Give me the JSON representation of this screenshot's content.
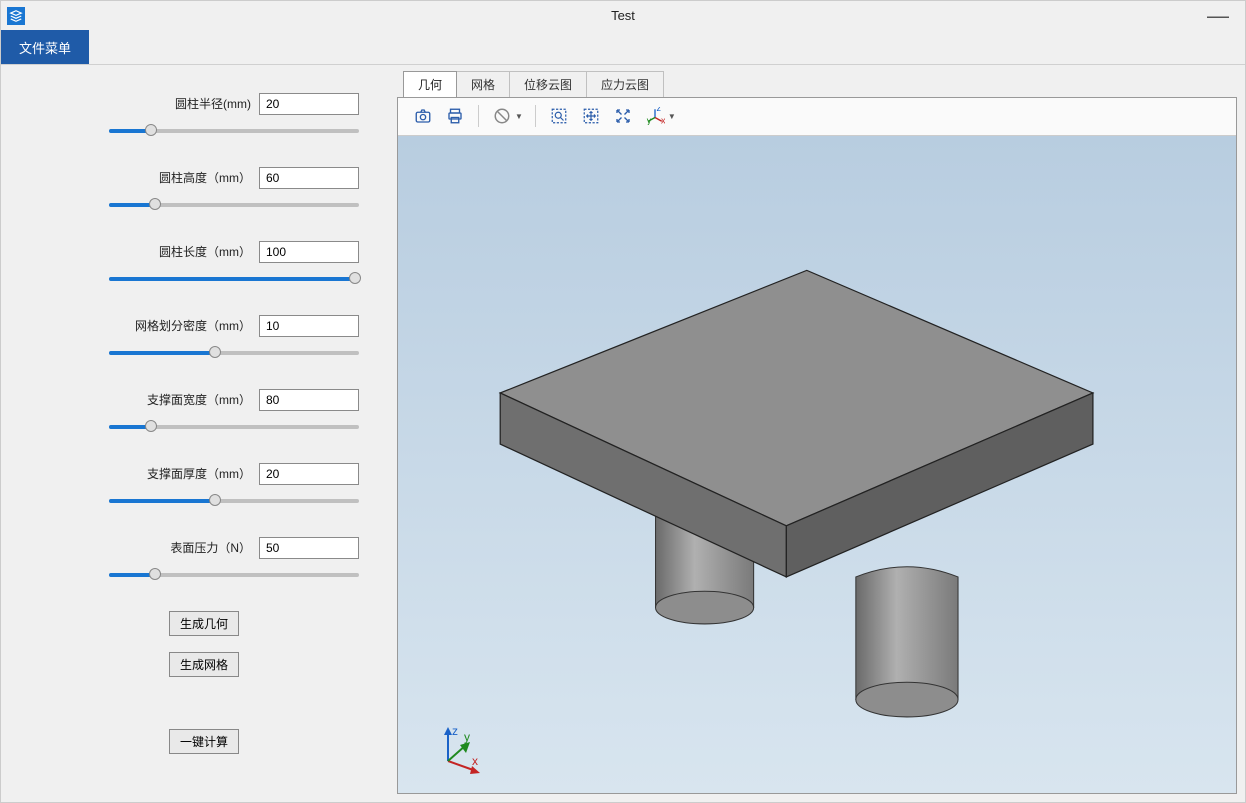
{
  "window": {
    "title": "Test"
  },
  "menubar": {
    "file_menu": "文件菜单"
  },
  "params": {
    "radius": {
      "label": "圆柱半径(mm)",
      "value": "20",
      "fill": 20,
      "thumb": 96
    },
    "height": {
      "label": "圆柱高度（mm）",
      "value": "60",
      "fill": 22,
      "thumb": 100
    },
    "length": {
      "label": "圆柱长度（mm）",
      "value": "100",
      "fill": 100,
      "thumb": 298
    },
    "mesh": {
      "label": "网格划分密度（mm）",
      "value": "10",
      "fill": 55,
      "thumb": 160
    },
    "sup_w": {
      "label": "支撑面宽度（mm）",
      "value": "80",
      "fill": 20,
      "thumb": 96
    },
    "sup_t": {
      "label": "支撑面厚度（mm）",
      "value": "20",
      "fill": 55,
      "thumb": 160
    },
    "pressure": {
      "label": "表面压力（N）",
      "value": "50",
      "fill": 22,
      "thumb": 100
    }
  },
  "buttons": {
    "gen_geom": "生成几何",
    "gen_mesh": "生成网格",
    "calc": "一键计算"
  },
  "tabs": {
    "geom": "几何",
    "mesh": "网格",
    "disp": "位移云图",
    "stress": "应力云图"
  },
  "triad": {
    "x": "x",
    "y": "y",
    "z": "z"
  }
}
